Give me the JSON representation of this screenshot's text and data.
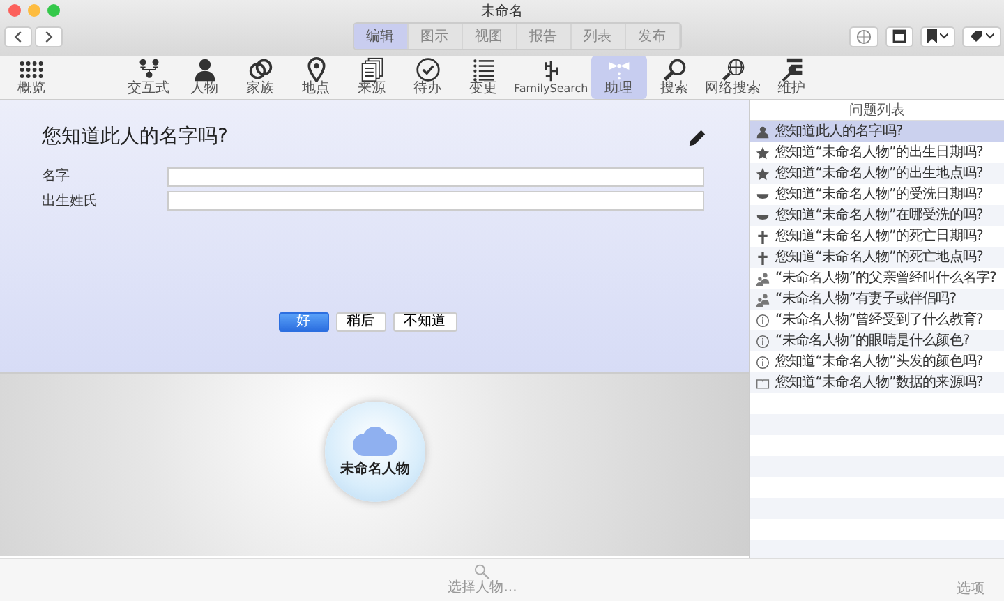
{
  "window": {
    "title": "未命名"
  },
  "tabs": [
    {
      "label": "编辑",
      "selected": true
    },
    {
      "label": "图示",
      "selected": false
    },
    {
      "label": "视图",
      "selected": false
    },
    {
      "label": "报告",
      "selected": false
    },
    {
      "label": "列表",
      "selected": false
    },
    {
      "label": "发布",
      "selected": false
    }
  ],
  "toolbar": [
    {
      "kind": "grid",
      "label": "概览",
      "selected": false
    },
    {
      "kind": "chart",
      "label": "交互式",
      "selected": false
    },
    {
      "kind": "person",
      "label": "人物",
      "selected": false
    },
    {
      "kind": "rings",
      "label": "家族",
      "selected": false
    },
    {
      "kind": "pin",
      "label": "地点",
      "selected": false
    },
    {
      "kind": "docs",
      "label": "来源",
      "selected": false
    },
    {
      "kind": "check",
      "label": "待办",
      "selected": false
    },
    {
      "kind": "list",
      "label": "变更",
      "selected": false
    },
    {
      "kind": "tree",
      "label": "FamilySearch",
      "selected": false
    },
    {
      "kind": "bowtie",
      "label": "助理",
      "selected": true
    },
    {
      "kind": "search",
      "label": "搜索",
      "selected": false
    },
    {
      "kind": "globe",
      "label": "网络搜索",
      "selected": false
    },
    {
      "kind": "tools",
      "label": "维护",
      "selected": false
    }
  ],
  "assistant": {
    "question": "您知道此人的名字吗?",
    "fields": [
      {
        "label": "名字"
      },
      {
        "label": "出生姓氏"
      }
    ],
    "buttons": [
      {
        "label": "好",
        "default": true
      },
      {
        "label": "稍后",
        "default": false
      },
      {
        "label": "不知道",
        "default": false
      }
    ]
  },
  "person_node": {
    "name": "未命名人物"
  },
  "question_list": {
    "title": "问题列表",
    "items": [
      {
        "kind": "person",
        "text": "您知道此人的名字吗?",
        "selected": true
      },
      {
        "kind": "star",
        "text": "您知道“未命名人物”的出生日期吗?",
        "selected": false
      },
      {
        "kind": "star",
        "text": "您知道“未命名人物”的出生地点吗?",
        "selected": false
      },
      {
        "kind": "bowl",
        "text": "您知道“未命名人物”的受洗日期吗?",
        "selected": false
      },
      {
        "kind": "bowl",
        "text": "您知道“未命名人物”在哪受洗的吗?",
        "selected": false
      },
      {
        "kind": "cross",
        "text": "您知道“未命名人物”的死亡日期吗?",
        "selected": false
      },
      {
        "kind": "cross",
        "text": "您知道“未命名人物”的死亡地点吗?",
        "selected": false
      },
      {
        "kind": "parents",
        "text": "“未命名人物”的父亲曾经叫什么名字?",
        "selected": false
      },
      {
        "kind": "parents",
        "text": "“未命名人物”有妻子或伴侣吗?",
        "selected": false
      },
      {
        "kind": "info",
        "text": "“未命名人物”曾经受到了什么教育?",
        "selected": false
      },
      {
        "kind": "info",
        "text": "“未命名人物”的眼睛是什么颜色?",
        "selected": false
      },
      {
        "kind": "info",
        "text": "您知道“未命名人物”头发的颜色吗?",
        "selected": false
      },
      {
        "kind": "book",
        "text": "您知道“未命名人物”数据的来源吗?",
        "selected": false
      }
    ]
  },
  "bottom_bar": {
    "search_label": "选择人物...",
    "options_label": "选项"
  }
}
